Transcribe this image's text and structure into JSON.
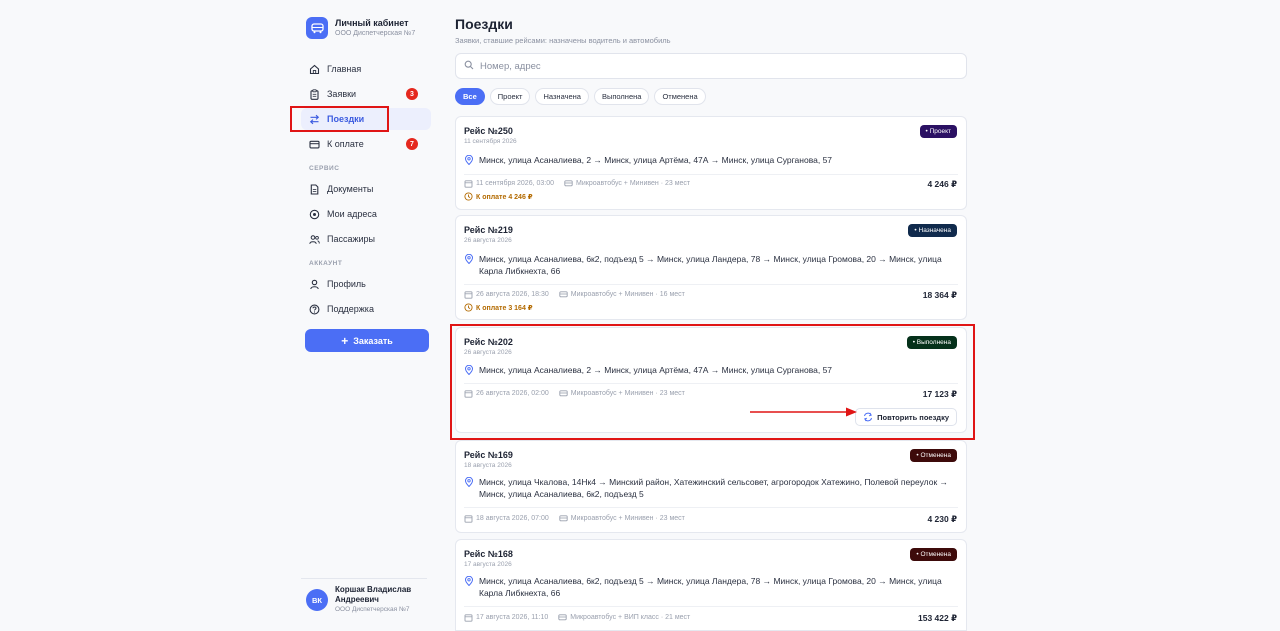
{
  "sidebar": {
    "brand_title": "Личный кабинет",
    "brand_sub": "ООО Диспетчерская №7",
    "nav": [
      {
        "label": "Главная",
        "icon": "home-icon"
      },
      {
        "label": "Заявки",
        "icon": "clipboard-icon",
        "badge": "3"
      },
      {
        "label": "Поездки",
        "icon": "swap-icon",
        "active": true
      },
      {
        "label": "К оплате",
        "icon": "card-icon",
        "badge": "7"
      }
    ],
    "section_service": "СЕРВИС",
    "service_nav": [
      {
        "label": "Документы",
        "icon": "document-icon"
      },
      {
        "label": "Мои адреса",
        "icon": "location-icon"
      },
      {
        "label": "Пассажиры",
        "icon": "users-icon"
      }
    ],
    "section_account": "АККАУНТ",
    "account_nav": [
      {
        "label": "Профиль",
        "icon": "user-icon"
      },
      {
        "label": "Поддержка",
        "icon": "help-icon"
      }
    ],
    "order_button": "Заказать",
    "user": {
      "initials": "ВК",
      "name": "Коршак Владислав Андреевич",
      "org": "ООО Диспетчерская №7"
    }
  },
  "main": {
    "title": "Поездки",
    "subtitle": "Заявки, ставшие рейсами: назначены водитель и автомобиль",
    "search_placeholder": "Номер, адрес",
    "filters": [
      "Все",
      "Проект",
      "Назначена",
      "Выполнена",
      "Отменена"
    ],
    "active_filter": "Все",
    "repeat_label": "Повторить поездку",
    "trips": [
      {
        "title": "Рейс №250",
        "date": "11 сентября 2026",
        "status": "• Проект",
        "route": "Минск, улица Асаналиева, 2 → Минск, улица Артёма, 47А → Минск, улица Сурганова, 57",
        "datetime": "11 сентября 2026, 03:00",
        "vehicle": "Микроавтобус + Минивен · 23 мест",
        "price": "4 246 ₽",
        "pay": "К оплате 4 246 ₽"
      },
      {
        "title": "Рейс №219",
        "date": "26 августа 2026",
        "status": "• Назначена",
        "route": "Минск, улица Асаналиева, 6к2, подъезд 5 → Минск, улица Ландера, 78 → Минск, улица Громова, 20 → Минск, улица Карла Либкнехта, 66",
        "datetime": "26 августа 2026, 18:30",
        "vehicle": "Микроавтобус + Минивен · 16 мест",
        "price": "18 364 ₽",
        "pay": "К оплате 3 164 ₽"
      },
      {
        "title": "Рейс №202",
        "date": "26 августа 2026",
        "status": "• Выполнена",
        "route": "Минск, улица Асаналиева, 2 → Минск, улица Артёма, 47А → Минск, улица Сурганова, 57",
        "datetime": "26 августа 2026, 02:00",
        "vehicle": "Микроавтобус + Минивен · 23 мест",
        "price": "17 123 ₽"
      },
      {
        "title": "Рейс №169",
        "date": "18 августа 2026",
        "status": "• Отменена",
        "route": "Минск, улица Чкалова, 14Нк4 → Минский район, Хатежинский сельсовет, агрогородок Хатежино, Полевой переулок → Минск, улица Асаналиева, 6к2, подъезд 5",
        "datetime": "18 августа 2026, 07:00",
        "vehicle": "Микроавтобус + Минивен · 23 мест",
        "price": "4 230 ₽"
      },
      {
        "title": "Рейс №168",
        "date": "17 августа 2026",
        "status": "• Отменена",
        "route": "Минск, улица Асаналиева, 6к2, подъезд 5 → Минск, улица Ландера, 78 → Минск, улица Громова, 20 → Минск, улица Карла Либкнехта, 66",
        "datetime": "17 августа 2026, 11:10",
        "vehicle": "Микроавтобус + ВИП класс · 21 мест",
        "price": "153 422 ₽"
      }
    ]
  },
  "colors": {
    "accent": "#4b6ef5",
    "badge": "#e5281e",
    "highlight": "#e01515",
    "pay": "#b36a00"
  }
}
